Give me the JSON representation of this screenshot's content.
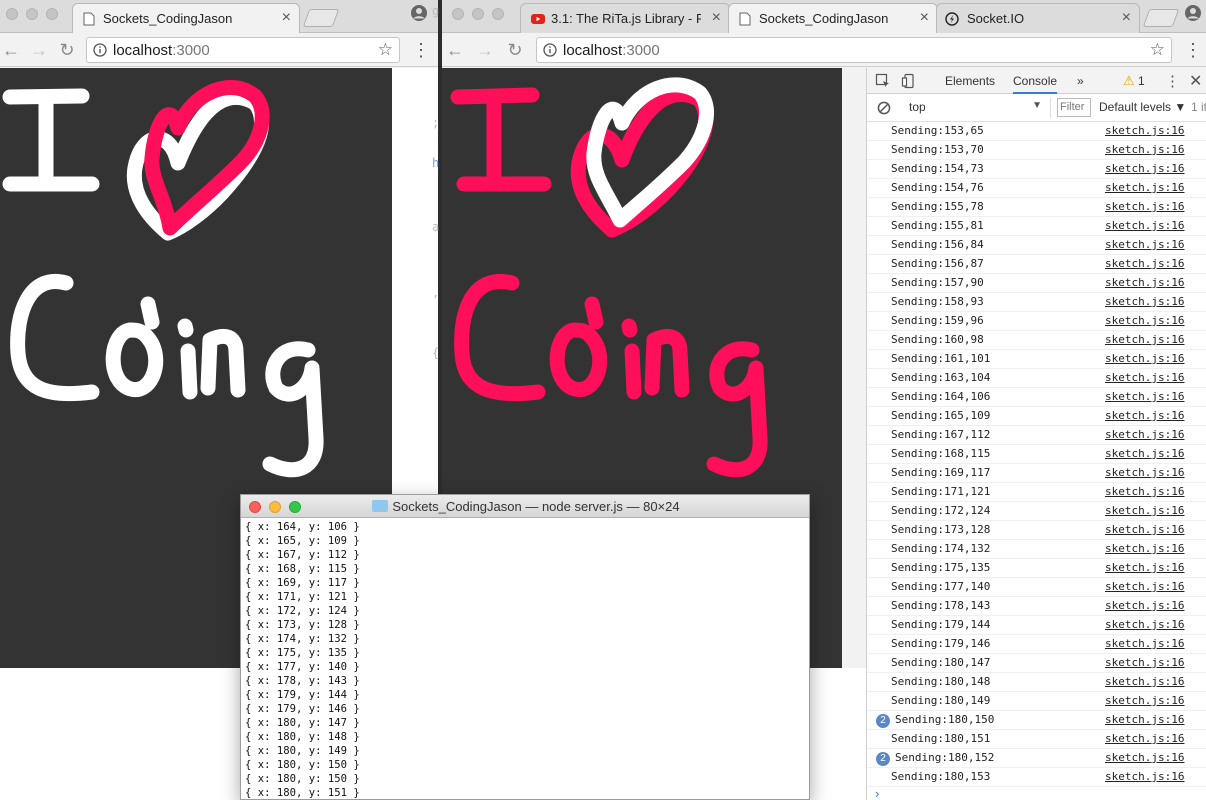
{
  "left_window": {
    "tab": {
      "title": "Sockets_CodingJason",
      "close": "×"
    },
    "url": {
      "host": "localhost",
      "port": ":3000"
    },
    "menu": "⋮"
  },
  "right_window": {
    "tabs": [
      {
        "title": "3.1: The RiTa.js Library - P",
        "close": "×",
        "icon": "youtube-icon"
      },
      {
        "title": "Sockets_CodingJason",
        "close": "×",
        "icon": "document-icon"
      },
      {
        "title": "Socket.IO",
        "close": "×",
        "icon": "socketio-icon"
      }
    ],
    "url": {
      "host": "localhost",
      "port": ":3000"
    },
    "menu": "⋮"
  },
  "canvas_left": {
    "text": "I ♥ Coding",
    "stroke_color": "#ffffff",
    "overlay_color": "#ff0e5a",
    "background": "#333333"
  },
  "canvas_right": {
    "text": "I ♥ Coding",
    "stroke_color": "#ff0e5a",
    "overlay_color": "#ffffff",
    "background": "#333333"
  },
  "devtools": {
    "tabs": [
      "Elements",
      "Console",
      "»"
    ],
    "active_tab": "Console",
    "warnings": "1",
    "context": "top",
    "filter_placeholder": "Filter",
    "levels": "Default levels ▼",
    "levels_extra": "1 it",
    "prompt": "›",
    "logs": [
      {
        "msg": "Sending:153,65",
        "src": "sketch.js:16"
      },
      {
        "msg": "Sending:153,70",
        "src": "sketch.js:16"
      },
      {
        "msg": "Sending:154,73",
        "src": "sketch.js:16"
      },
      {
        "msg": "Sending:154,76",
        "src": "sketch.js:16"
      },
      {
        "msg": "Sending:155,78",
        "src": "sketch.js:16"
      },
      {
        "msg": "Sending:155,81",
        "src": "sketch.js:16"
      },
      {
        "msg": "Sending:156,84",
        "src": "sketch.js:16"
      },
      {
        "msg": "Sending:156,87",
        "src": "sketch.js:16"
      },
      {
        "msg": "Sending:157,90",
        "src": "sketch.js:16"
      },
      {
        "msg": "Sending:158,93",
        "src": "sketch.js:16"
      },
      {
        "msg": "Sending:159,96",
        "src": "sketch.js:16"
      },
      {
        "msg": "Sending:160,98",
        "src": "sketch.js:16"
      },
      {
        "msg": "Sending:161,101",
        "src": "sketch.js:16"
      },
      {
        "msg": "Sending:163,104",
        "src": "sketch.js:16"
      },
      {
        "msg": "Sending:164,106",
        "src": "sketch.js:16"
      },
      {
        "msg": "Sending:165,109",
        "src": "sketch.js:16"
      },
      {
        "msg": "Sending:167,112",
        "src": "sketch.js:16"
      },
      {
        "msg": "Sending:168,115",
        "src": "sketch.js:16"
      },
      {
        "msg": "Sending:169,117",
        "src": "sketch.js:16"
      },
      {
        "msg": "Sending:171,121",
        "src": "sketch.js:16"
      },
      {
        "msg": "Sending:172,124",
        "src": "sketch.js:16"
      },
      {
        "msg": "Sending:173,128",
        "src": "sketch.js:16"
      },
      {
        "msg": "Sending:174,132",
        "src": "sketch.js:16"
      },
      {
        "msg": "Sending:175,135",
        "src": "sketch.js:16"
      },
      {
        "msg": "Sending:177,140",
        "src": "sketch.js:16"
      },
      {
        "msg": "Sending:178,143",
        "src": "sketch.js:16"
      },
      {
        "msg": "Sending:179,144",
        "src": "sketch.js:16"
      },
      {
        "msg": "Sending:179,146",
        "src": "sketch.js:16"
      },
      {
        "msg": "Sending:180,147",
        "src": "sketch.js:16"
      },
      {
        "msg": "Sending:180,148",
        "src": "sketch.js:16"
      },
      {
        "msg": "Sending:180,149",
        "src": "sketch.js:16"
      },
      {
        "msg": "Sending:180,150",
        "src": "sketch.js:16",
        "count": "2"
      },
      {
        "msg": "Sending:180,151",
        "src": "sketch.js:16"
      },
      {
        "msg": "Sending:180,152",
        "src": "sketch.js:16",
        "count": "2"
      },
      {
        "msg": "Sending:180,153",
        "src": "sketch.js:16"
      }
    ]
  },
  "terminal": {
    "title": "Sockets_CodingJason — node server.js — 80×24",
    "lines": [
      "{ x: 164, y: 106 }",
      "{ x: 165, y: 109 }",
      "{ x: 167, y: 112 }",
      "{ x: 168, y: 115 }",
      "{ x: 169, y: 117 }",
      "{ x: 171, y: 121 }",
      "{ x: 172, y: 124 }",
      "{ x: 173, y: 128 }",
      "{ x: 174, y: 132 }",
      "{ x: 175, y: 135 }",
      "{ x: 177, y: 140 }",
      "{ x: 178, y: 143 }",
      "{ x: 179, y: 144 }",
      "{ x: 179, y: 146 }",
      "{ x: 180, y: 147 }",
      "{ x: 180, y: 148 }",
      "{ x: 180, y: 149 }",
      "{ x: 180, y: 150 }",
      "{ x: 180, y: 150 }",
      "{ x: 180, y: 151 }"
    ]
  }
}
